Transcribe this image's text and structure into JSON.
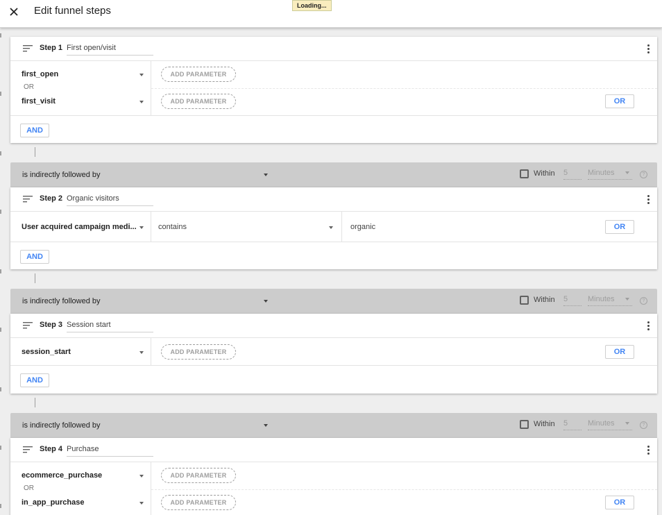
{
  "header": {
    "title": "Edit funnel steps",
    "close_icon": "close-icon",
    "loading": "Loading..."
  },
  "steps": [
    {
      "label": "Step 1",
      "name": "First open/visit",
      "events": [
        "first_open",
        "first_visit"
      ],
      "or_label": "OR",
      "param_label": "ADD PARAMETER",
      "or_button": "OR",
      "and_button": "AND"
    },
    {
      "label": "Step 2",
      "name": "Organic visitors",
      "condition": {
        "dimension": "User acquired campaign medi...",
        "operator": "contains",
        "value": "organic"
      },
      "or_button": "OR",
      "and_button": "AND"
    },
    {
      "label": "Step 3",
      "name": "Session start",
      "events": [
        "session_start"
      ],
      "param_label": "ADD PARAMETER",
      "or_button": "OR",
      "and_button": "AND"
    },
    {
      "label": "Step 4",
      "name": "Purchase",
      "events": [
        "ecommerce_purchase",
        "in_app_purchase"
      ],
      "or_label": "OR",
      "param_label": "ADD PARAMETER",
      "or_button": "OR"
    }
  ],
  "sequence": {
    "relation": "is indirectly followed by",
    "within_label": "Within",
    "within_value": "5",
    "within_unit": "Minutes",
    "help": "?"
  },
  "colors": {
    "accent": "#4285f4",
    "bar": "#cccccc",
    "loading_bg": "#f9edbe"
  }
}
